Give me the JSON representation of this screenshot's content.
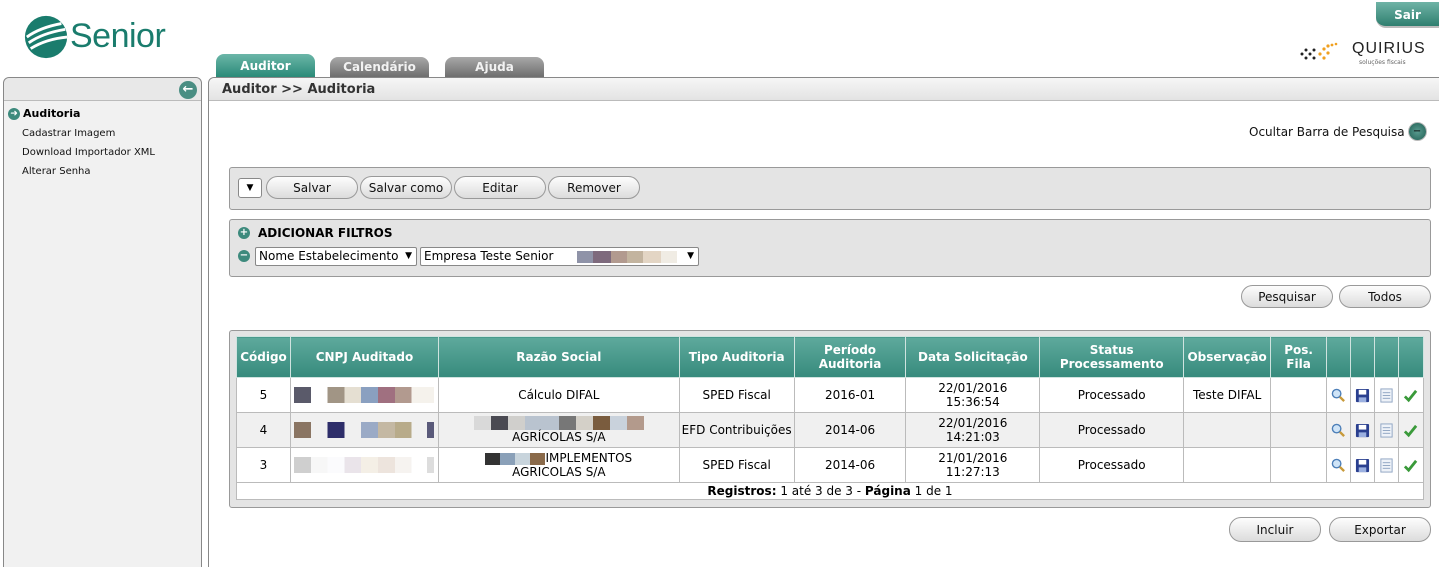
{
  "header": {
    "logo_text": "Senior",
    "exit_label": "Sair",
    "partner_name": "QUIRIUS",
    "partner_sub": "soluções fiscais"
  },
  "tabs": [
    {
      "label": "Auditor",
      "active": true
    },
    {
      "label": "Calendário",
      "active": false
    },
    {
      "label": "Ajuda",
      "active": false
    }
  ],
  "sidebar": {
    "section": "Auditoria",
    "items": [
      {
        "label": "Cadastrar Imagem"
      },
      {
        "label": "Download Importador XML"
      },
      {
        "label": "Alterar Senha"
      }
    ]
  },
  "main": {
    "breadcrumb": "Auditor >> Auditoria",
    "hide_search_label": "Ocultar Barra de Pesquisa"
  },
  "toolbar": {
    "dropdown_symbol": "▼",
    "save": "Salvar",
    "save_as": "Salvar como",
    "edit": "Editar",
    "remove": "Remover"
  },
  "filters": {
    "title": "ADICIONAR FILTROS",
    "field": "Nome Estabelecimento",
    "value": "Empresa Teste Senior"
  },
  "search": {
    "search_label": "Pesquisar",
    "all_label": "Todos"
  },
  "table": {
    "headers": [
      "Código",
      "CNPJ Auditado",
      "Razão Social",
      "Tipo Auditoria",
      "Período Auditoria",
      "Data Solicitação",
      "Status Processamento",
      "Observação",
      "Pos. Fila"
    ],
    "rows": [
      {
        "codigo": "5",
        "razao": "Cálculo DIFAL",
        "tipo": "SPED Fiscal",
        "periodo": "2016-01",
        "data": "22/01/2016",
        "hora": "15:36:54",
        "status": "Processado",
        "obs": "Teste DIFAL",
        "fila": ""
      },
      {
        "codigo": "4",
        "razao": "AGRÍCOLAS S/A",
        "tipo": "EFD Contribuições",
        "periodo": "2014-06",
        "data": "22/01/2016",
        "hora": "14:21:03",
        "status": "Processado",
        "obs": "",
        "fila": ""
      },
      {
        "codigo": "3",
        "razao_line1": "IMPLEMENTOS",
        "razao": "AGRICOLAS S/A",
        "tipo": "SPED Fiscal",
        "periodo": "2014-06",
        "data": "21/01/2016",
        "hora": "11:27:13",
        "status": "Processado",
        "obs": "",
        "fila": ""
      }
    ],
    "footer": {
      "registros_label": "Registros:",
      "registros_value": "1 até 3 de 3 -",
      "pagina_label": "Página",
      "pagina_value": "1 de 1"
    }
  },
  "actions": {
    "include": "Incluir",
    "export": "Exportar"
  },
  "colors": {
    "accent": "#2a8a78",
    "header_teal": "#5ea99c"
  }
}
